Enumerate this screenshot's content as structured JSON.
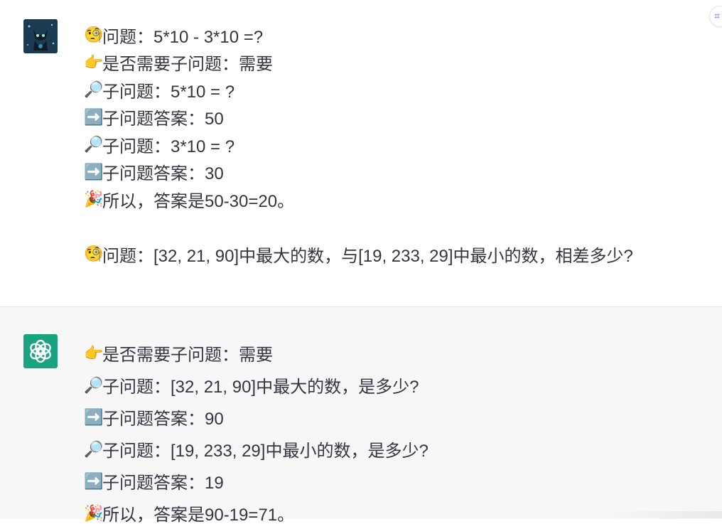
{
  "user_message": {
    "lines": [
      {
        "emoji": "🧐",
        "text": "问题：5*10 - 3*10 =?"
      },
      {
        "emoji": "👉",
        "text": "是否需要子问题：需要"
      },
      {
        "emoji": "🔎",
        "text": "子问题：5*10 = ?"
      },
      {
        "emoji": "➡️",
        "text": "子问题答案：50"
      },
      {
        "emoji": "🔎",
        "text": "子问题：3*10 = ?"
      },
      {
        "emoji": "➡️",
        "text": "子问题答案：30"
      },
      {
        "emoji": "🎉",
        "text": "所以，答案是50-30=20。"
      },
      {
        "emoji": "🧐",
        "text": "问题：[32, 21, 90]中最大的数，与[19, 233, 29]中最小的数，相差多少?"
      }
    ]
  },
  "assistant_message": {
    "lines": [
      {
        "emoji": "👉",
        "text": "是否需要子问题：需要"
      },
      {
        "emoji": "🔎",
        "text": "子问题：[32, 21, 90]中最大的数，是多少?"
      },
      {
        "emoji": "➡️",
        "text": "子问题答案：90"
      },
      {
        "emoji": "🔎",
        "text": "子问题：[19, 233, 29]中最小的数，是多少?"
      },
      {
        "emoji": "➡️",
        "text": "子问题答案：19"
      },
      {
        "emoji": "🎉",
        "text": "所以，答案是90-19=71。"
      }
    ]
  },
  "colors": {
    "assistant_background": "#f7f7f8",
    "assistant_avatar": "#19a37f",
    "text": "#343541"
  },
  "icons": {
    "user_avatar": "cat-avatar-icon",
    "assistant_avatar": "openai-logo-icon",
    "corner": "scan-icon"
  }
}
